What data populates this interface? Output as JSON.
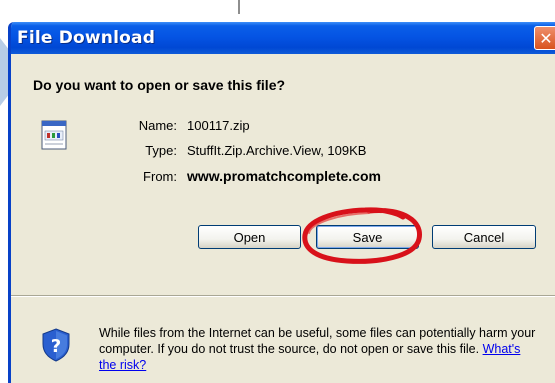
{
  "dialog": {
    "title": "File Download",
    "close_glyph": "✕",
    "question": "Do you want to open or save this file?"
  },
  "file": {
    "icon": "zip-file-icon",
    "name_label": "Name:",
    "name_value": "100117.zip",
    "type_label": "Type:",
    "type_value": "StuffIt.Zip.Archive.View, 109KB",
    "from_label": "From:",
    "from_value": "www.promatchcomplete.com"
  },
  "buttons": {
    "open": "Open",
    "save": "Save",
    "cancel": "Cancel"
  },
  "warning": {
    "icon": "shield-question-icon",
    "text": "While files from the Internet can be useful, some files can potentially harm your computer. If you do not trust the source, do not open or save this file. ",
    "link": "What's the risk?"
  },
  "colors": {
    "titlebar": "#0554e4",
    "dialog_bg": "#ece9d8",
    "close": "#d9531f",
    "highlight_ring": "#d8111a",
    "link": "#0000ee"
  }
}
